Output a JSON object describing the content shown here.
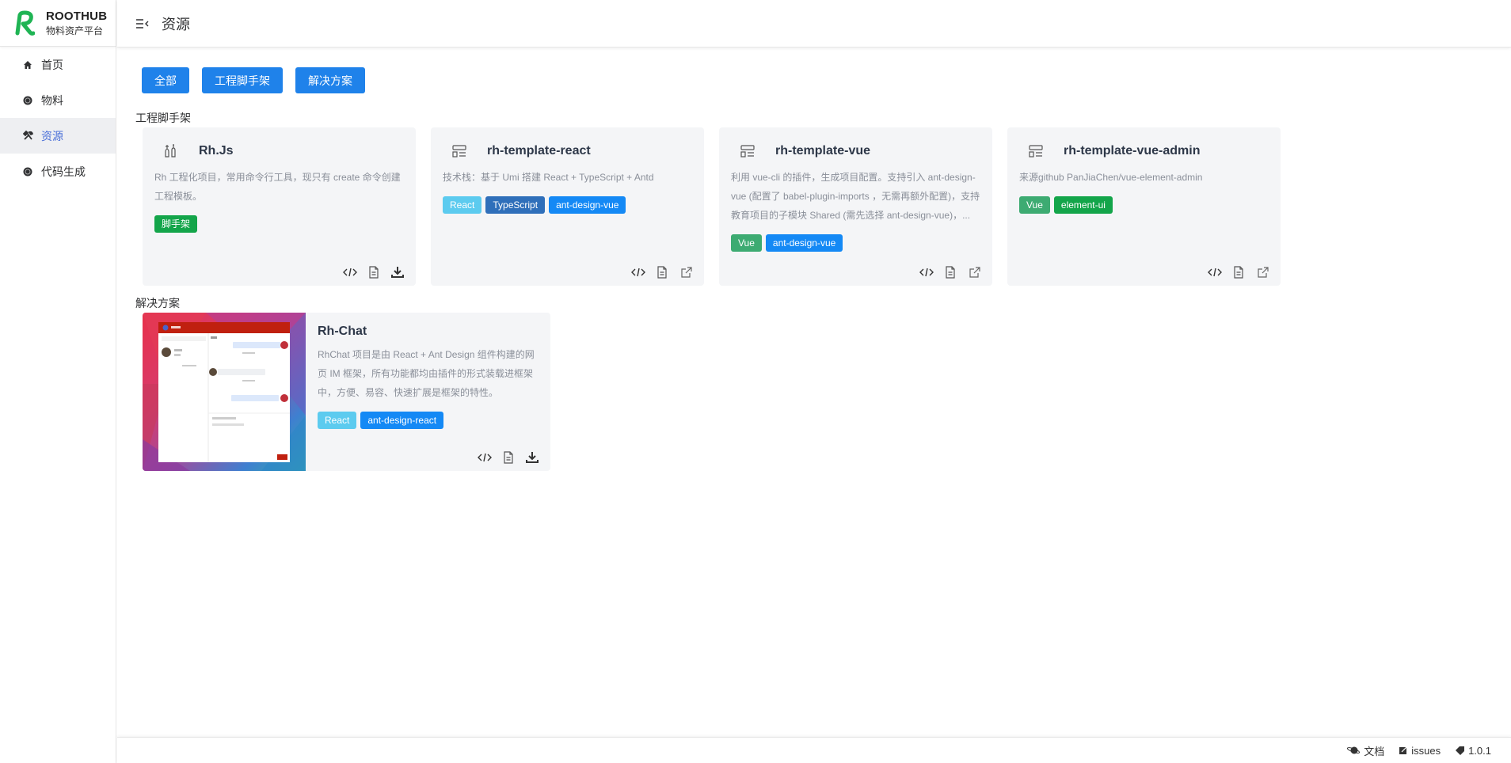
{
  "brand": {
    "name": "ROOTHUB",
    "subtitle": "物料资产平台",
    "color": "#1fb454"
  },
  "sidebar": {
    "items": [
      {
        "label": "首页",
        "icon": "home-icon",
        "active": false
      },
      {
        "label": "物料",
        "icon": "circle-icon",
        "active": false
      },
      {
        "label": "资源",
        "icon": "tools-icon",
        "active": true
      },
      {
        "label": "代码生成",
        "icon": "circle-icon",
        "active": false
      }
    ]
  },
  "header": {
    "title": "资源",
    "fold_icon": "menu-fold-icon"
  },
  "filters": [
    {
      "label": "全部"
    },
    {
      "label": "工程脚手架"
    },
    {
      "label": "解决方案"
    }
  ],
  "sections": {
    "scaffold": {
      "title": "工程脚手架",
      "cards": [
        {
          "name": "Rh.Js",
          "icon": "tools-icon",
          "description": "Rh 工程化项目，常用命令行工具，现只有 create 命令创建工程模板。",
          "tags": [
            {
              "label": "脚手架",
              "color": "#13a54a"
            }
          ],
          "actions": [
            "code-icon",
            "document-icon",
            "download-icon"
          ]
        },
        {
          "name": "rh-template-react",
          "icon": "template-icon",
          "description": "技术栈：基于 Umi 搭建 React + TypeScript + Antd",
          "tags": [
            {
              "label": "React",
              "color": "#5ccbef"
            },
            {
              "label": "TypeScript",
              "color": "#2f6fba"
            },
            {
              "label": "ant-design-vue",
              "color": "#1489f5"
            }
          ],
          "actions": [
            "code-icon",
            "document-icon",
            "external-link-icon"
          ]
        },
        {
          "name": "rh-template-vue",
          "icon": "template-icon",
          "description": "利用 vue-cli 的插件，生成项目配置。支持引入 ant-design-vue (配置了 babel-plugin-imports ，无需再额外配置)，支持教育项目的子模块 Shared (需先选择 ant-design-vue)，...",
          "tags": [
            {
              "label": "Vue",
              "color": "#3dab72"
            },
            {
              "label": "ant-design-vue",
              "color": "#1489f5"
            }
          ],
          "actions": [
            "code-icon",
            "document-icon",
            "external-link-icon"
          ]
        },
        {
          "name": "rh-template-vue-admin",
          "icon": "template-icon",
          "description": "来源github PanJiaChen/vue-element-admin",
          "tags": [
            {
              "label": "Vue",
              "color": "#3dab72"
            },
            {
              "label": "element-ui",
              "color": "#13a54a"
            }
          ],
          "actions": [
            "code-icon",
            "document-icon",
            "external-link-icon"
          ]
        }
      ]
    },
    "solutions": {
      "title": "解决方案",
      "cards": [
        {
          "name": "Rh-Chat",
          "description": "RhChat 项目是由 React + Ant Design 组件构建的网页 IM 框架，所有功能都均由插件的形式装载进框架中，方便、易容、快速扩展是框架的特性。",
          "tags": [
            {
              "label": "React",
              "color": "#5ccbef"
            },
            {
              "label": "ant-design-react",
              "color": "#1489f5"
            }
          ],
          "actions": [
            "code-icon",
            "document-icon",
            "download-icon"
          ]
        }
      ]
    }
  },
  "footer": {
    "links": [
      {
        "label": "文档",
        "icon": "planet-icon"
      },
      {
        "label": "issues",
        "icon": "edit-icon"
      },
      {
        "label": "1.0.1",
        "icon": "tag-icon"
      }
    ]
  }
}
